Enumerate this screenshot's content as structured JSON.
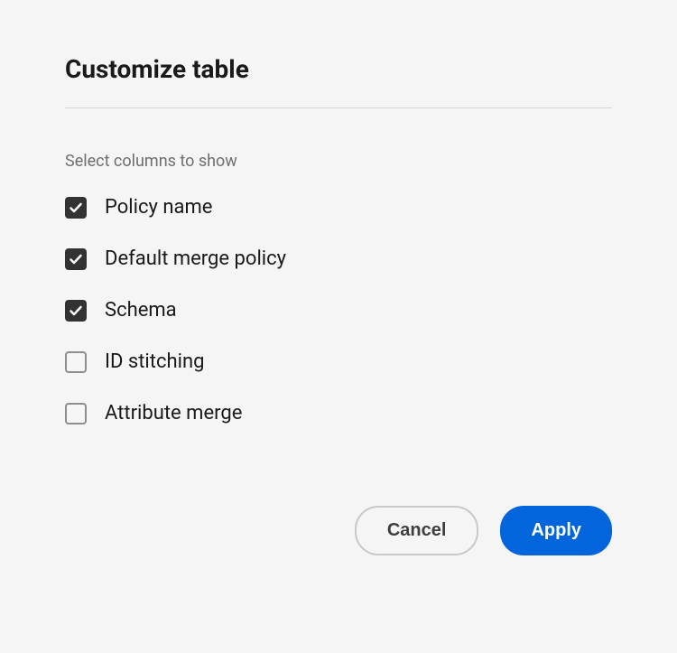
{
  "dialog": {
    "title": "Customize table",
    "subtitle": "Select columns to show",
    "columns": [
      {
        "label": "Policy name",
        "checked": true
      },
      {
        "label": "Default merge policy",
        "checked": true
      },
      {
        "label": "Schema",
        "checked": true
      },
      {
        "label": "ID stitching",
        "checked": false
      },
      {
        "label": "Attribute merge",
        "checked": false
      }
    ],
    "buttons": {
      "cancel": "Cancel",
      "apply": "Apply"
    }
  }
}
